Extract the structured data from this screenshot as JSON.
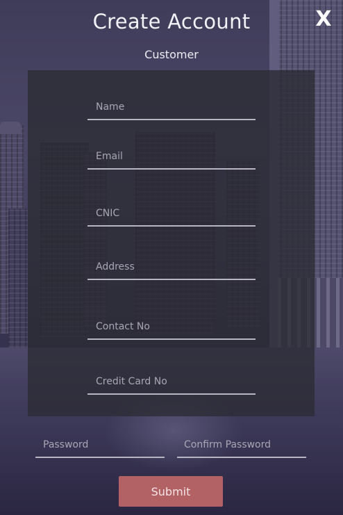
{
  "header": {
    "title": "Create Account",
    "subtitle": "Customer",
    "close_label": "X"
  },
  "form": {
    "fields": [
      {
        "id": "name",
        "placeholder": "Name",
        "value": ""
      },
      {
        "id": "email",
        "placeholder": "Email",
        "value": ""
      },
      {
        "id": "cnic",
        "placeholder": "CNIC",
        "value": ""
      },
      {
        "id": "address",
        "placeholder": "Address",
        "value": ""
      },
      {
        "id": "contact",
        "placeholder": "Contact No",
        "value": ""
      },
      {
        "id": "credit_card",
        "placeholder": "Credit Card No",
        "value": ""
      }
    ],
    "password": {
      "placeholder": "Password",
      "value": ""
    },
    "confirm_password": {
      "placeholder": "Confirm Password",
      "value": ""
    },
    "submit_label": "Submit"
  },
  "colors": {
    "submit_bg": "#b26164",
    "panel_bg": "rgba(44,44,52,0.80)",
    "underline": "#b9b6c4"
  }
}
